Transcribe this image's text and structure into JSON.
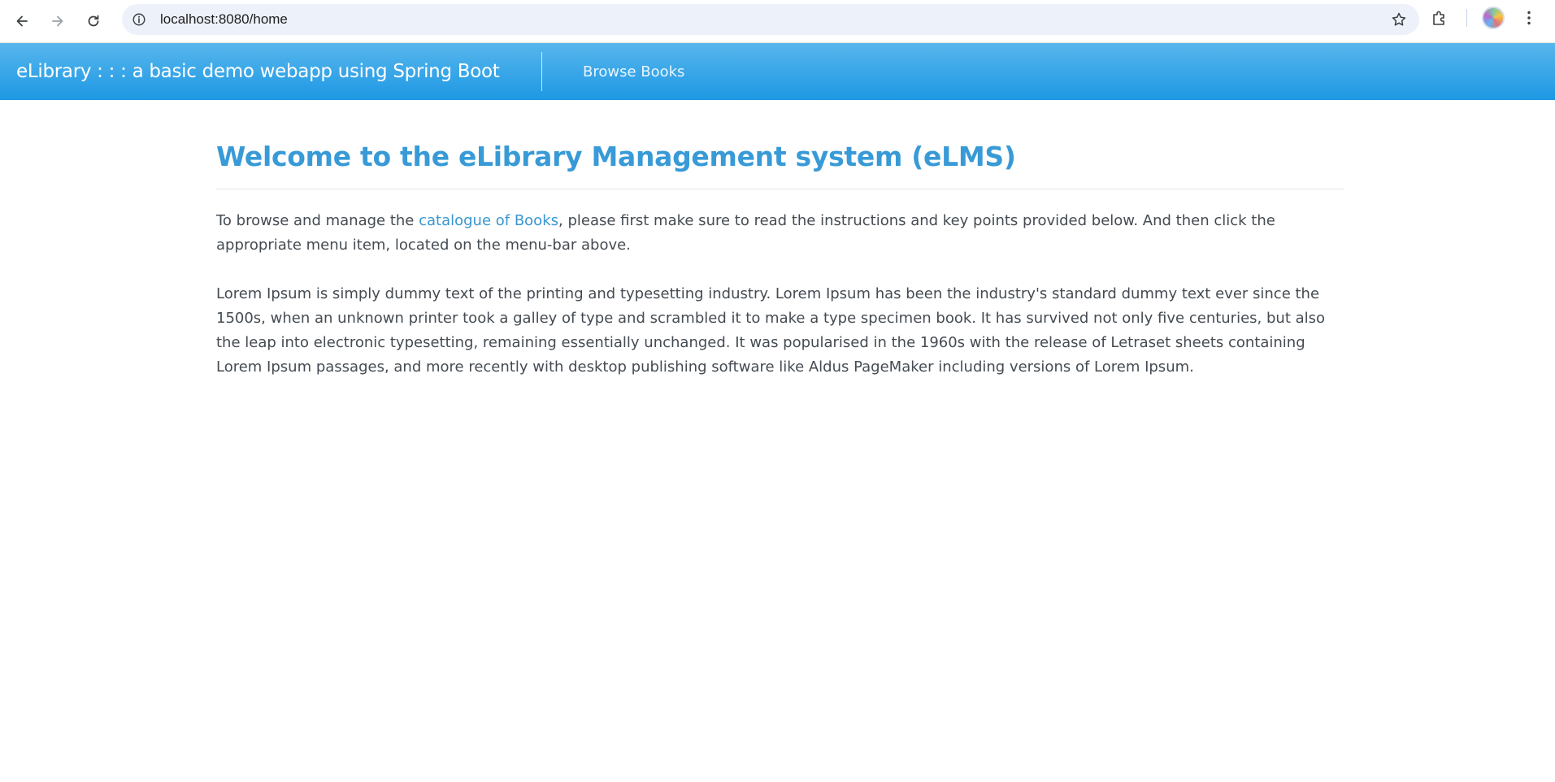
{
  "browser": {
    "url": "localhost:8080/home"
  },
  "navbar": {
    "brand": "eLibrary : : : a basic demo webapp using Spring Boot",
    "links": [
      "Browse Books"
    ]
  },
  "main": {
    "title": "Welcome to the eLibrary Management system (eLMS)",
    "intro_before_link": "To browse and manage the ",
    "intro_link": "catalogue of Books",
    "intro_after_link": ", please first make sure to read the instructions and key points provided below. And then click the appropriate menu item, located on the menu-bar above.",
    "lorem": "Lorem Ipsum is simply dummy text of the printing and typesetting industry. Lorem Ipsum has been the industry's standard dummy text ever since the 1500s, when an unknown printer took a galley of type and scrambled it to make a type specimen book. It has survived not only five centuries, but also the leap into electronic typesetting, remaining essentially unchanged. It was popularised in the 1960s with the release of Letraset sheets containing Lorem Ipsum passages, and more recently with desktop publishing software like Aldus PageMaker including versions of Lorem Ipsum."
  },
  "colors": {
    "navbar_top": "#57b6ec",
    "navbar_bottom": "#1e98e4",
    "title": "#389ad6",
    "link": "#3896d2",
    "body_text": "#444b52"
  }
}
